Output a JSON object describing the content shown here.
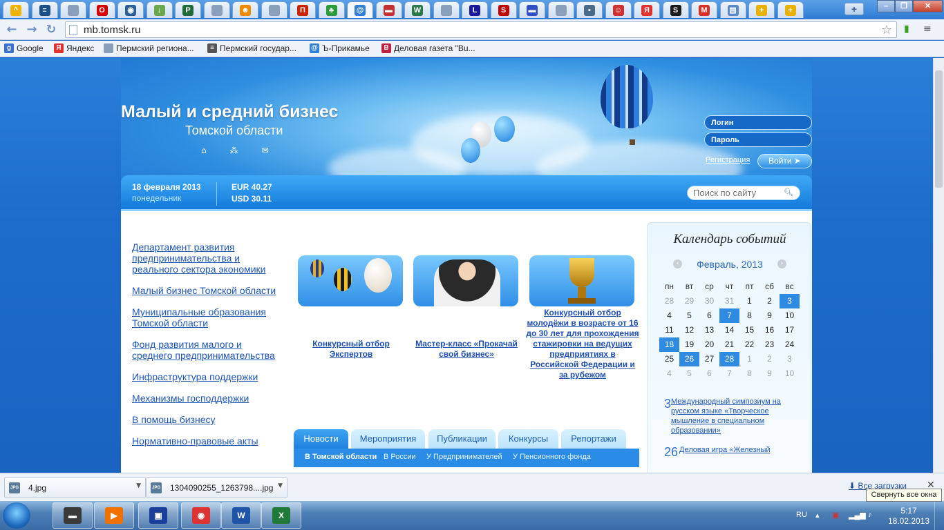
{
  "browser": {
    "tabs": [
      {
        "icon": "map-icon",
        "color": "#f0b400",
        "glyph": "^"
      },
      {
        "icon": "building-icon",
        "color": "#1b4f8a",
        "glyph": "≡"
      },
      {
        "icon": "page-icon",
        "color": "#8a9fba",
        "glyph": ""
      },
      {
        "icon": "opera-icon",
        "color": "#d40000",
        "glyph": "O"
      },
      {
        "icon": "globe-icon",
        "color": "#2a5f9a",
        "glyph": "◉"
      },
      {
        "icon": "arrow-icon",
        "color": "#6aa84f",
        "glyph": "↓"
      },
      {
        "icon": "p-icon",
        "color": "#1f6b3a",
        "glyph": "P"
      },
      {
        "icon": "page-icon",
        "color": "#8a9fba",
        "glyph": ""
      },
      {
        "icon": "people-icon",
        "color": "#f08a00",
        "glyph": "☻"
      },
      {
        "icon": "page-icon",
        "color": "#8a9fba",
        "glyph": ""
      },
      {
        "icon": "pi-icon",
        "color": "#cc2200",
        "glyph": "П"
      },
      {
        "icon": "leaf-icon",
        "color": "#2a9a3a",
        "glyph": "♣"
      },
      {
        "icon": "swirl-icon",
        "color": "#2f80d8",
        "glyph": "@"
      },
      {
        "icon": "flag-icon",
        "color": "#c43030",
        "glyph": "▬"
      },
      {
        "icon": "shield-icon",
        "color": "#2a7a4a",
        "glyph": "W"
      },
      {
        "icon": "page-icon",
        "color": "#8a9fba",
        "glyph": ""
      },
      {
        "icon": "l-icon",
        "color": "#1a1a9a",
        "glyph": "L"
      },
      {
        "icon": "s-icon",
        "color": "#c00000",
        "glyph": "S"
      },
      {
        "icon": "flag-icon",
        "color": "#3050c0",
        "glyph": "▬"
      },
      {
        "icon": "page-icon",
        "color": "#8a9fba",
        "glyph": ""
      },
      {
        "icon": "chat-icon",
        "color": "#4a6a8a",
        "glyph": "▪"
      },
      {
        "icon": "smile-icon",
        "color": "#d03030",
        "glyph": "☺"
      },
      {
        "icon": "yandex-icon",
        "color": "#e03030",
        "glyph": "Я"
      },
      {
        "icon": "s-icon",
        "color": "#1a1a1a",
        "glyph": "S"
      },
      {
        "icon": "gmail-icon",
        "color": "#d93025",
        "glyph": "M"
      },
      {
        "icon": "doc-icon",
        "color": "#5a88c8",
        "glyph": "▤"
      },
      {
        "icon": "plus-icon",
        "color": "#e8b000",
        "glyph": "+"
      },
      {
        "icon": "plus-icon",
        "color": "#e8b000",
        "glyph": "+"
      }
    ],
    "new_tab_label": "+",
    "window_controls": {
      "minimize": "–",
      "restore": "❐",
      "close": "✕"
    },
    "url": "mb.tomsk.ru",
    "bookmarks": [
      {
        "label": "Google",
        "icon": "google-icon",
        "color": "#3b6fd4",
        "glyph": "g"
      },
      {
        "label": "Яндекс",
        "icon": "yandex-icon",
        "color": "#e03030",
        "glyph": "Я"
      },
      {
        "label": "Пермский региона...",
        "icon": "page-icon",
        "color": "#8a9fba",
        "glyph": ""
      },
      {
        "label": "Пермский государ...",
        "icon": "building-icon",
        "color": "#555",
        "glyph": "≡"
      },
      {
        "label": "Ъ-Прикамье",
        "icon": "swirl-icon",
        "color": "#2f80d8",
        "glyph": "@"
      },
      {
        "label": "Деловая газета \"Bu...",
        "icon": "b-icon",
        "color": "#c02040",
        "glyph": "B"
      }
    ]
  },
  "site": {
    "title": "Малый и средний бизнес",
    "subtitle": "Томской области",
    "header_icons": [
      "home-icon",
      "sitemap-icon",
      "mail-icon"
    ],
    "login_placeholder": "Логин",
    "password_placeholder": "Пароль",
    "register_link": "Регистрация",
    "login_button": "Войти ➤",
    "date": "18 февраля 2013",
    "weekday": "понедельник",
    "eur": "EUR 40.27",
    "usd": "USD 30.11",
    "search_placeholder": "Поиск по сайту",
    "left_nav": [
      "Департамент развития предпринимательства и реального сектора экономики",
      "Малый бизнес Томской области",
      "Муниципальные образования Томской области",
      "Фонд развития малого и среднего предпринимательства",
      "Инфраструктура поддержки",
      "Механизмы господдержки",
      "В помощь бизнесу",
      "Нормативно-правовые акты"
    ],
    "promos": [
      {
        "caption": "Конкурсный отбор Экспертов"
      },
      {
        "caption": "Мастер-класс «Прокачай свой бизнес»"
      },
      {
        "caption": "Конкурсный отбор молодёжи в возрасте от 16 до 30 лет для прохождения стажировки на ведущих предприятиях в Российской Федерации и за рубежом"
      }
    ],
    "news_tabs": [
      "Новости",
      "Мероприятия",
      "Публикации",
      "Конкурсы",
      "Репортажи"
    ],
    "news_subtabs": [
      "В Томской области",
      "В России",
      "У Предпринимателей",
      "У Пенсионного фонда"
    ],
    "calendar": {
      "title": "Календарь событий",
      "month": "Февраль, 2013",
      "prev": "‹",
      "next": "›",
      "weekdays": [
        "пн",
        "вт",
        "ср",
        "чт",
        "пт",
        "сб",
        "вс"
      ],
      "weeks": [
        [
          "28",
          "29",
          "30",
          "31",
          "1",
          "2",
          "3"
        ],
        [
          "4",
          "5",
          "6",
          "7",
          "8",
          "9",
          "10"
        ],
        [
          "11",
          "12",
          "13",
          "14",
          "15",
          "16",
          "17"
        ],
        [
          "18",
          "19",
          "20",
          "21",
          "22",
          "23",
          "24"
        ],
        [
          "25",
          "26",
          "27",
          "28",
          "1",
          "2",
          "3"
        ],
        [
          "4",
          "5",
          "6",
          "7",
          "8",
          "9",
          "10"
        ]
      ],
      "muted": [
        [
          0,
          0
        ],
        [
          0,
          1
        ],
        [
          0,
          2
        ],
        [
          0,
          3
        ],
        [
          4,
          4
        ],
        [
          4,
          5
        ],
        [
          4,
          6
        ],
        [
          5,
          0
        ],
        [
          5,
          1
        ],
        [
          5,
          2
        ],
        [
          5,
          3
        ],
        [
          5,
          4
        ],
        [
          5,
          5
        ],
        [
          5,
          6
        ]
      ],
      "highlighted": [
        [
          0,
          6
        ],
        [
          1,
          3
        ],
        [
          3,
          0
        ],
        [
          4,
          1
        ],
        [
          4,
          3
        ]
      ],
      "events": [
        {
          "day": "3",
          "text": "Международный симпозиум на русском языке «Творческое мышление в специальном образовании»"
        },
        {
          "day": "26",
          "text": "Деловая игра «Железный"
        }
      ]
    }
  },
  "downloads": {
    "items": [
      {
        "name": "4.jpg",
        "type": "JPG"
      },
      {
        "name": "1304090255_1263798....jpg",
        "type": "JPG"
      }
    ],
    "all_downloads": "Все загрузки",
    "close": "✕",
    "tooltip": "Свернуть все окна"
  },
  "taskbar": {
    "apps": [
      {
        "icon": "folder-icon",
        "color": "#3a3a3a",
        "glyph": "▬"
      },
      {
        "icon": "media-player-icon",
        "color": "#f07000",
        "glyph": "▶"
      },
      {
        "icon": "floppy-icon",
        "color": "#1a3f9a",
        "glyph": "▣"
      },
      {
        "icon": "chrome-icon",
        "color": "#d33",
        "glyph": "◉"
      },
      {
        "icon": "word-icon",
        "color": "#1f55a8",
        "glyph": "W"
      },
      {
        "icon": "excel-icon",
        "color": "#1f7a3a",
        "glyph": "X"
      }
    ],
    "language": "RU",
    "time": "5:17",
    "date": "18.02.2013"
  }
}
